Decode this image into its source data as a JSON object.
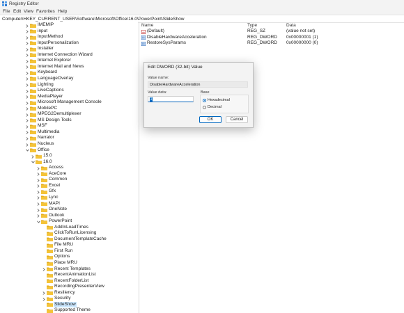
{
  "window": {
    "title": "Registry Editor"
  },
  "menu": [
    "File",
    "Edit",
    "View",
    "Favorites",
    "Help"
  ],
  "address": "Computer\\HKEY_CURRENT_USER\\Software\\Microsoft\\Office\\16.0\\PowerPoint\\SlideShow",
  "tree": [
    {
      "label": "IMEMIP",
      "level": 0,
      "expander": "right"
    },
    {
      "label": "input",
      "level": 0,
      "expander": "right"
    },
    {
      "label": "InputMethod",
      "level": 0,
      "expander": "right"
    },
    {
      "label": "InputPersonalization",
      "level": 0,
      "expander": "right"
    },
    {
      "label": "Installer",
      "level": 0,
      "expander": "right"
    },
    {
      "label": "Internet Connection Wizard",
      "level": 0,
      "expander": "right"
    },
    {
      "label": "Internet Explorer",
      "level": 0,
      "expander": "right"
    },
    {
      "label": "Internet Mail and News",
      "level": 0,
      "expander": "right"
    },
    {
      "label": "Keyboard",
      "level": 0,
      "expander": "right"
    },
    {
      "label": "LanguageOverlay",
      "level": 0,
      "expander": "right"
    },
    {
      "label": "Lighting",
      "level": 0,
      "expander": "right"
    },
    {
      "label": "LiveCaptions",
      "level": 0,
      "expander": "right"
    },
    {
      "label": "MediaPlayer",
      "level": 0,
      "expander": "right"
    },
    {
      "label": "Microsoft Management Console",
      "level": 0,
      "expander": "right"
    },
    {
      "label": "MobilePC",
      "level": 0,
      "expander": "right"
    },
    {
      "label": "MPEG2Demultiplexer",
      "level": 0,
      "expander": "right"
    },
    {
      "label": "MS Design Tools",
      "level": 0,
      "expander": "right"
    },
    {
      "label": "MSF",
      "level": 0,
      "expander": "right"
    },
    {
      "label": "Multimedia",
      "level": 0,
      "expander": "right"
    },
    {
      "label": "Narrator",
      "level": 0,
      "expander": "right"
    },
    {
      "label": "Nucleus",
      "level": 0,
      "expander": "right"
    },
    {
      "label": "Office",
      "level": 0,
      "expander": "down"
    },
    {
      "label": "15.0",
      "level": 1,
      "expander": "right"
    },
    {
      "label": "16.0",
      "level": 1,
      "expander": "down"
    },
    {
      "label": "Access",
      "level": 2,
      "expander": "right"
    },
    {
      "label": "AceCore",
      "level": 2,
      "expander": "right"
    },
    {
      "label": "Common",
      "level": 2,
      "expander": "right"
    },
    {
      "label": "Excel",
      "level": 2,
      "expander": "right"
    },
    {
      "label": "Gfx",
      "level": 2,
      "expander": "right"
    },
    {
      "label": "Lync",
      "level": 2,
      "expander": "right"
    },
    {
      "label": "MAPI",
      "level": 2,
      "expander": "right"
    },
    {
      "label": "OneNote",
      "level": 2,
      "expander": "right"
    },
    {
      "label": "Outlook",
      "level": 2,
      "expander": "right"
    },
    {
      "label": "PowerPoint",
      "level": 2,
      "expander": "down"
    },
    {
      "label": "AddInLoadTimes",
      "level": 3,
      "expander": "none"
    },
    {
      "label": "ClickToRunLicensing",
      "level": 3,
      "expander": "none"
    },
    {
      "label": "DocumentTemplateCache",
      "level": 3,
      "expander": "none"
    },
    {
      "label": "File MRU",
      "level": 3,
      "expander": "none"
    },
    {
      "label": "First Run",
      "level": 3,
      "expander": "none"
    },
    {
      "label": "Options",
      "level": 3,
      "expander": "none"
    },
    {
      "label": "Place MRU",
      "level": 3,
      "expander": "none"
    },
    {
      "label": "Recent Templates",
      "level": 3,
      "expander": "right"
    },
    {
      "label": "RecentAnimationList",
      "level": 3,
      "expander": "none"
    },
    {
      "label": "RecentFolderList",
      "level": 3,
      "expander": "none"
    },
    {
      "label": "RecordingPresenterView",
      "level": 3,
      "expander": "none"
    },
    {
      "label": "Resiliency",
      "level": 3,
      "expander": "right"
    },
    {
      "label": "Security",
      "level": 3,
      "expander": "right"
    },
    {
      "label": "SlideShow",
      "level": 3,
      "expander": "none",
      "selected": true
    },
    {
      "label": "Supported Theme",
      "level": 3,
      "expander": "none"
    }
  ],
  "values": {
    "columns": {
      "name": "Name",
      "type": "Type",
      "data": "Data"
    },
    "rows": [
      {
        "name": "(Default)",
        "type": "REG_SZ",
        "data": "(value not set)",
        "icon": "string-value-icon"
      },
      {
        "name": "DisableHardwareAcceleration",
        "type": "REG_DWORD",
        "data": "0x00000001 (1)",
        "icon": "dword-value-icon"
      },
      {
        "name": "RestoreSysParams",
        "type": "REG_DWORD",
        "data": "0x00000000 (0)",
        "icon": "dword-value-icon"
      }
    ]
  },
  "dialog": {
    "title": "Edit DWORD (32-bit) Value",
    "value_name_label": "Value name:",
    "value_name": "DisableHardwareAcceleration",
    "value_data_label": "Value data:",
    "value_data": "1",
    "base_label": "Base",
    "base_options": [
      "Hexadecimal",
      "Decimal"
    ],
    "base_selected": "Hexadecimal",
    "ok_label": "OK",
    "cancel_label": "Cancel"
  },
  "colors": {
    "folder": "#f4c338",
    "folder_dark": "#e0a919",
    "selection": "#cce8ff",
    "accent": "#0067c0"
  }
}
